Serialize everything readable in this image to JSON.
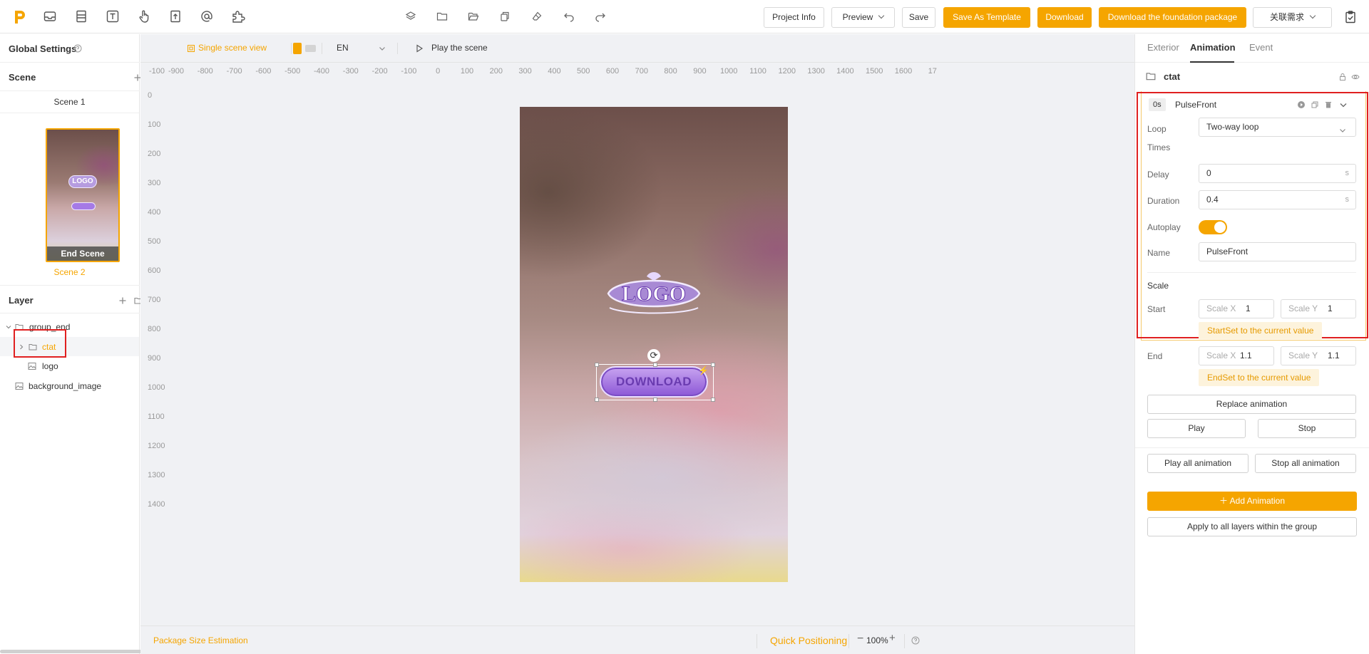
{
  "toolbar": {
    "project_info": "Project Info",
    "preview": "Preview",
    "save": "Save",
    "save_as_template": "Save As Template",
    "download": "Download",
    "download_foundation": "Download the foundation package",
    "related_requirements": "关联需求",
    "accent_color": "#f5a500"
  },
  "left": {
    "global_settings": "Global Settings",
    "scene_header": "Scene",
    "scene1_label": "Scene 1",
    "end_scene_label": "End Scene",
    "scene2_label": "Scene 2",
    "layer_header": "Layer",
    "layers": {
      "group_end": "group_end",
      "ctat": "ctat",
      "logo": "logo",
      "background_image": "background_image"
    }
  },
  "canvas": {
    "single_scene_view": "Single scene view",
    "language": "EN",
    "play_scene": "Play the scene",
    "ruler_h": [
      "-100",
      "-900",
      "-800",
      "-700",
      "-600",
      "-500",
      "-400",
      "-300",
      "-200",
      "-100",
      "0",
      "100",
      "200",
      "300",
      "400",
      "500",
      "600",
      "700",
      "800",
      "900",
      "1000",
      "1100",
      "1200",
      "1300",
      "1400",
      "1500",
      "1600",
      "17"
    ],
    "ruler_v": [
      "0",
      "100",
      "200",
      "300",
      "400",
      "500",
      "600",
      "700",
      "800",
      "900",
      "1000",
      "1100",
      "1200",
      "1300",
      "1400"
    ],
    "logo_text": "LOGO",
    "download_button": "DOWNLOAD",
    "package_size": "Package Size Estimation",
    "quick_positioning": "Quick Positioning",
    "zoom": "100%"
  },
  "right": {
    "tabs": {
      "exterior": "Exterior",
      "animation": "Animation",
      "event": "Event"
    },
    "layer_name": "ctat",
    "anim_time": "0s",
    "anim_name": "PulseFront",
    "loop_label": "Loop",
    "loop_value": "Two-way loop",
    "times_label": "Times",
    "delay_label": "Delay",
    "delay_value": "0",
    "duration_label": "Duration",
    "duration_value": "0.4",
    "unit_s": "s",
    "autoplay_label": "Autoplay",
    "autoplay_on": true,
    "name_label": "Name",
    "name_value": "PulseFront",
    "scale_label": "Scale",
    "start_label": "Start",
    "end_label": "End",
    "scale_x": "Scale X",
    "scale_y": "Scale Y",
    "start_x": "1",
    "start_y": "1",
    "end_x": "1.1",
    "end_y": "1.1",
    "start_hint": "StartSet to the current value",
    "end_hint": "EndSet to the current value",
    "replace_animation": "Replace animation",
    "play": "Play",
    "stop": "Stop",
    "play_all": "Play all animation",
    "stop_all": "Stop all animation",
    "add_animation": "Add Animation",
    "apply_group": "Apply to all layers within the group"
  }
}
